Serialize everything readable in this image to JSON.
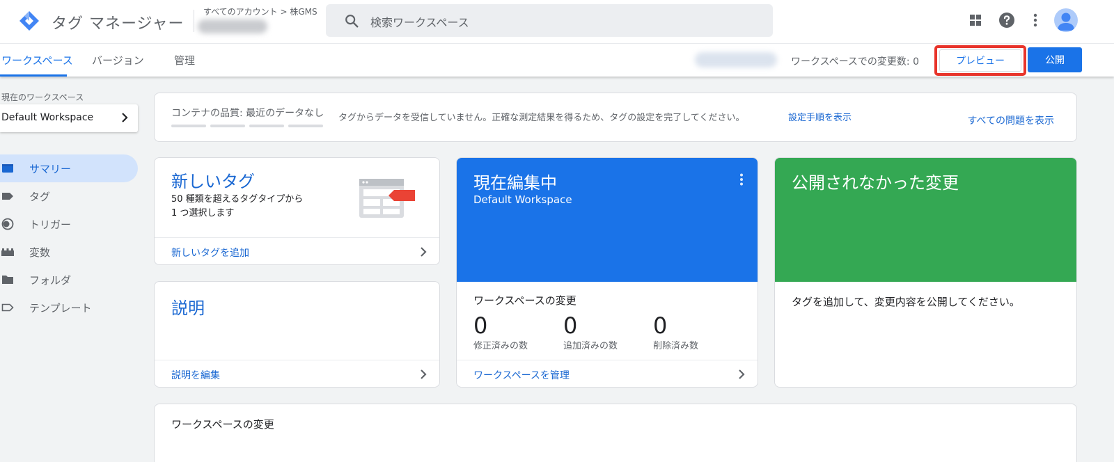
{
  "header": {
    "app_title": "タグ マネージャー",
    "breadcrumb": "すべてのアカウント > 株GMS",
    "search_placeholder": "検索ワークスペース"
  },
  "tabs": [
    {
      "label": "ワークスペース",
      "active": true
    },
    {
      "label": "バージョン",
      "active": false
    },
    {
      "label": "管理",
      "active": false
    }
  ],
  "toolbar": {
    "change_count_label": "ワークスペースでの変更数: 0",
    "preview_label": "プレビュー",
    "publish_label": "公開"
  },
  "sidebar": {
    "current_ws_label": "現在のワークスペース",
    "workspace_name": "Default Workspace",
    "items": [
      {
        "label": "サマリー",
        "icon": "summary-icon",
        "active": true
      },
      {
        "label": "タグ",
        "icon": "tag-icon",
        "active": false
      },
      {
        "label": "トリガー",
        "icon": "trigger-icon",
        "active": false
      },
      {
        "label": "変数",
        "icon": "variables-icon",
        "active": false
      },
      {
        "label": "フォルダ",
        "icon": "folder-icon",
        "active": false
      },
      {
        "label": "テンプレート",
        "icon": "template-icon",
        "active": false
      }
    ]
  },
  "quality": {
    "label": "コンテナの品質: 最近のデータなし",
    "message": "タグからデータを受信していません。正確な測定結果を得るため、タグの設定を完了してください。",
    "setup_link": "設定手順を表示",
    "all_issues_link": "すべての問題を表示"
  },
  "new_tag_card": {
    "title": "新しいタグ",
    "desc_line1": "50 種類を超えるタグタイプから",
    "desc_line2": "1 つ選択します",
    "footer_link": "新しいタグを追加"
  },
  "description_card": {
    "title": "説明",
    "footer_link": "説明を編集"
  },
  "editing_card": {
    "title": "現在編集中",
    "workspace": "Default Workspace",
    "section_title": "ワークスペースの変更",
    "stats": [
      {
        "value": "0",
        "label": "修正済みの数"
      },
      {
        "value": "0",
        "label": "追加済みの数"
      },
      {
        "value": "0",
        "label": "削除済み数"
      }
    ],
    "footer_link": "ワークスペースを管理"
  },
  "unpublished_card": {
    "title": "公開されなかった変更",
    "message": "タグを追加して、変更内容を公開してください。"
  },
  "bottom_card": {
    "title": "ワークスペースの変更"
  },
  "colors": {
    "accent_blue": "#1a73e8",
    "editing_card_blue": "#1a73e8",
    "unpublished_card_green": "#34a853",
    "preview_highlight_red": "#e8342b"
  }
}
